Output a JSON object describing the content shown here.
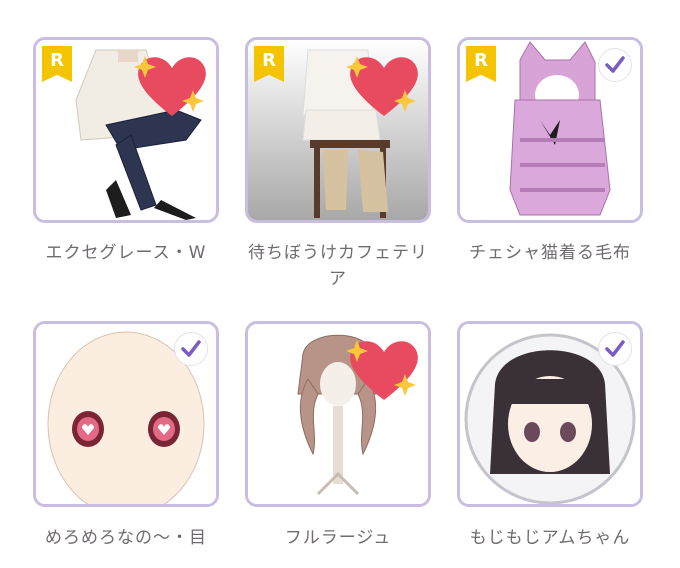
{
  "items": [
    {
      "name": "エクセグレース・W",
      "rarity": "R",
      "owned": false,
      "favorite": true
    },
    {
      "name": "待ちぼうけカフェテリア",
      "rarity": "R",
      "owned": false,
      "favorite": true
    },
    {
      "name": "チェシャ猫着る毛布",
      "rarity": "R",
      "owned": true,
      "favorite": false
    },
    {
      "name": "めろめろなの〜・目",
      "rarity": "",
      "owned": true,
      "favorite": false
    },
    {
      "name": "フルラージュ",
      "rarity": "",
      "owned": false,
      "favorite": true
    },
    {
      "name": "もじもじアムちゃん",
      "rarity": "",
      "owned": true,
      "favorite": false
    }
  ],
  "colors": {
    "border": "#c9bde2",
    "check": "#7b5cc4",
    "rarity": "#f5c400",
    "heart": "#e84a5f",
    "star": "#f8c83a"
  }
}
